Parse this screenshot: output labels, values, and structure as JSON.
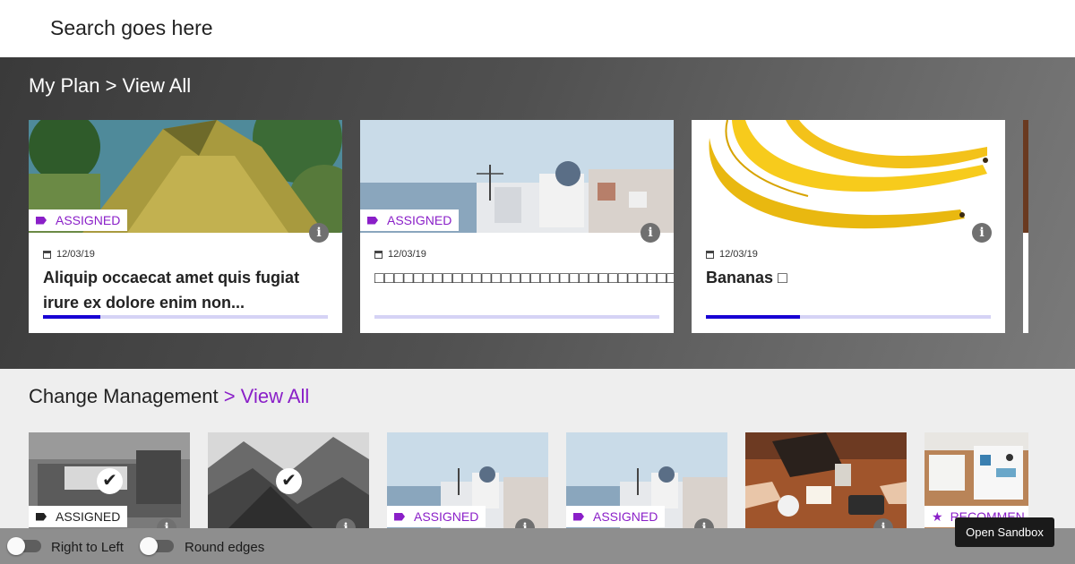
{
  "search": {
    "text": "Search goes here"
  },
  "my_plan": {
    "heading": "My Plan > View All",
    "cards": [
      {
        "tag": "ASSIGNED",
        "date": "12/03/19",
        "title": "Aliquip occaecat amet quis fugiat irure ex dolore enim non...",
        "progress": 0.2,
        "image": "tree-moss"
      },
      {
        "tag": "ASSIGNED",
        "date": "12/03/19",
        "title": "□□□□□□□□□□□□□□□□□□□□□□□□□□□□□□□",
        "progress": 0.0,
        "image": "santorini"
      },
      {
        "tag": "",
        "date": "12/03/19",
        "title": "Bananas □",
        "progress": 0.33,
        "image": "bananas"
      }
    ]
  },
  "change_management": {
    "heading": "Change Management",
    "view_all": "> View All",
    "cards": [
      {
        "tag": "ASSIGNED",
        "completed": true,
        "image": "truck-grayscale"
      },
      {
        "tag": "",
        "completed": true,
        "image": "mountains-grayscale"
      },
      {
        "tag": "ASSIGNED",
        "completed": false,
        "image": "santorini"
      },
      {
        "tag": "ASSIGNED",
        "completed": false,
        "image": "santorini"
      },
      {
        "tag": "",
        "completed": false,
        "image": "desk-people"
      },
      {
        "tag": "RECOMMEN",
        "completed": false,
        "image": "desk-stationery"
      }
    ]
  },
  "footer": {
    "rtl_label": "Right to Left",
    "round_label": "Round edges",
    "sandbox_label": "Open Sandbox"
  },
  "colors": {
    "accent": "#8a1fc8",
    "progress": "#1800d4",
    "progress_track": "#d5d3f5"
  }
}
